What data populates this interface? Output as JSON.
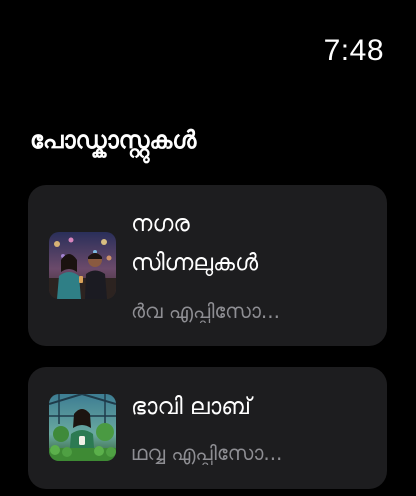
{
  "status_bar": {
    "time": "7:48"
  },
  "section": {
    "title": "പോഡ്കാസ്റ്റുകൾ"
  },
  "podcasts": [
    {
      "title_line1": "നഗര",
      "title_line2": "സിഗ്നലുകൾ",
      "subtitle": "ർവ എപ്പിസോ...",
      "thumbnail": "couple-city-night-artwork"
    },
    {
      "title_line1": "ഭാവി ലാബ്",
      "subtitle": "ഥവ്വ എപ്പിസോ...",
      "thumbnail": "woman-greenhouse-artwork"
    }
  ],
  "colors": {
    "background": "#000000",
    "card": "#1d1d1f",
    "text_primary": "#ffffff",
    "text_secondary": "#8e8e93"
  }
}
